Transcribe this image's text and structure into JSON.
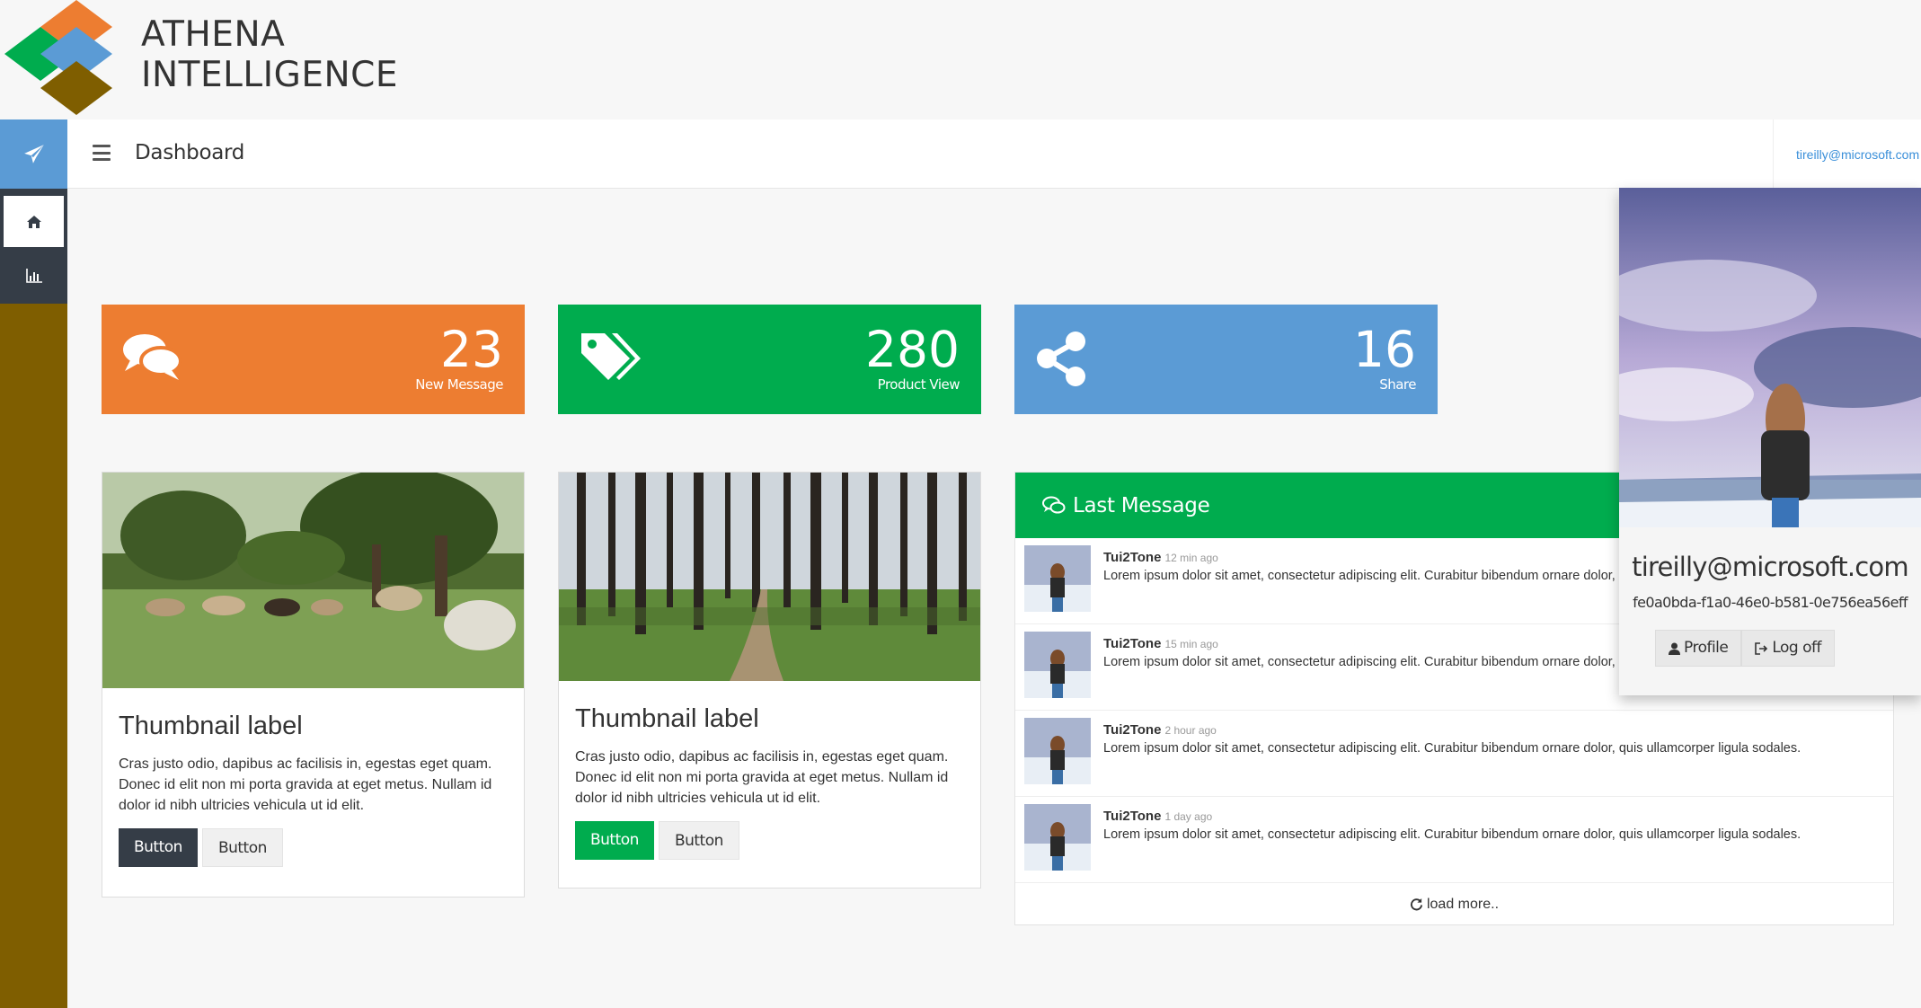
{
  "brand": {
    "line1": "ATHENA",
    "line2": "INTELLIGENCE",
    "icon": "diamond-logo-icon"
  },
  "colors": {
    "orange": "#ed7d31",
    "green": "#00ac4e",
    "blue": "#5b9bd5",
    "brown": "#7f5e00",
    "dark": "#353d47"
  },
  "sidebar": {
    "items": [
      {
        "icon": "paper-plane-icon"
      },
      {
        "icon": "home-icon",
        "active": true
      },
      {
        "icon": "bar-chart-icon"
      }
    ]
  },
  "topbar": {
    "title": "Dashboard",
    "user": "tireilly@microsoft.com"
  },
  "tiles": [
    {
      "value": "23",
      "label": "New Message",
      "icon": "comments-icon",
      "color": "#ed7d31"
    },
    {
      "value": "280",
      "label": "Product View",
      "icon": "tags-icon",
      "color": "#00ac4e"
    },
    {
      "value": "16",
      "label": "Share",
      "icon": "share-icon",
      "color": "#5b9bd5"
    }
  ],
  "thumbnails": [
    {
      "title": "Thumbnail label",
      "text": "Cras justo odio, dapibus ac facilisis in, egestas eget quam. Donec id elit non mi porta gravida at eget metus. Nullam id dolor id nibh ultricies vehicula ut id elit.",
      "primary": "Button",
      "secondary": "Button"
    },
    {
      "title": "Thumbnail label",
      "text": "Cras justo odio, dapibus ac facilisis in, egestas eget quam. Donec id elit non mi porta gravida at eget metus. Nullam id dolor id nibh ultricies vehicula ut id elit.",
      "primary": "Button",
      "secondary": "Button"
    }
  ],
  "messages_panel": {
    "title": "Last Message",
    "load_more": "load more..",
    "items": [
      {
        "name": "Tui2Tone",
        "time": "12 min ago",
        "text": "Lorem ipsum dolor sit amet, consectetur adipiscing elit. Curabitur bibendum ornare dolor, quis ullamcorper ligula sodales."
      },
      {
        "name": "Tui2Tone",
        "time": "15 min ago",
        "text": "Lorem ipsum dolor sit amet, consectetur adipiscing elit. Curabitur bibendum ornare dolor, quis ullamcorper ligula sodales."
      },
      {
        "name": "Tui2Tone",
        "time": "2 hour ago",
        "text": "Lorem ipsum dolor sit amet, consectetur adipiscing elit. Curabitur bibendum ornare dolor, quis ullamcorper ligula sodales."
      },
      {
        "name": "Tui2Tone",
        "time": "1 day ago",
        "text": "Lorem ipsum dolor sit amet, consectetur adipiscing elit. Curabitur bibendum ornare dolor, quis ullamcorper ligula sodales."
      }
    ]
  },
  "user_card": {
    "email": "tireilly@microsoft.com",
    "id": "fe0a0bda-f1a0-46e0-b581-0e756ea56eff",
    "profile": "Profile",
    "logoff": "Log off"
  }
}
